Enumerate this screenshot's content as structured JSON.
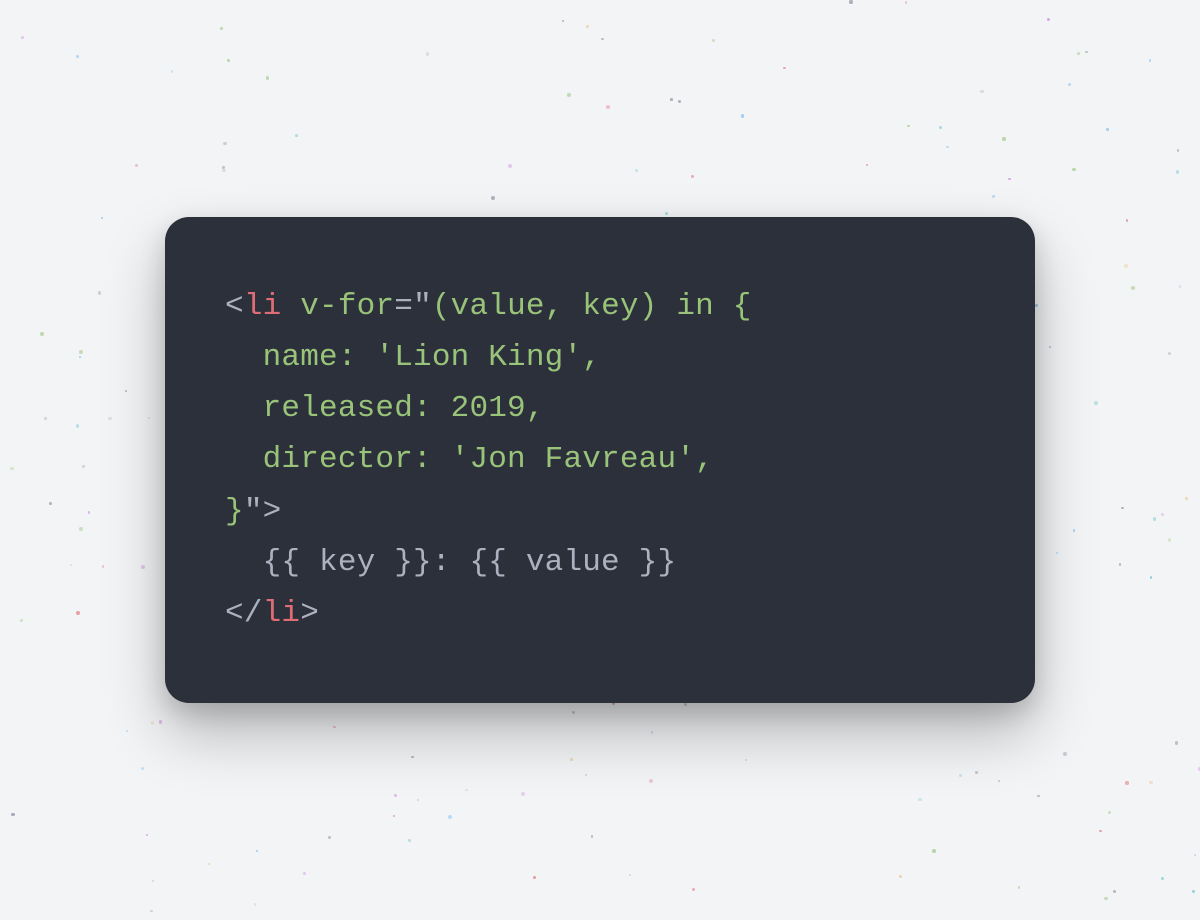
{
  "code": {
    "line1": {
      "bracket_open": "<",
      "tag": "li",
      "space": " ",
      "attr": "v-for",
      "eq": "=",
      "quote_open": "\"",
      "expr": "(value, key) in {"
    },
    "line2": "  name: 'Lion King',",
    "line3": "  released: 2019,",
    "line4": "  director: 'Jon Favreau',",
    "line5": {
      "close_brace": "}",
      "quote_close": "\"",
      "bracket_close": ">"
    },
    "line6": "  {{ key }}: {{ value }}",
    "line7": {
      "bracket_open": "</",
      "tag": "li",
      "bracket_close": ">"
    }
  },
  "colors": {
    "background": "#f2f4f6",
    "card": "#2b303b",
    "muted": "#abb2bf",
    "tag": "#e06c75",
    "attr": "#98c379"
  }
}
